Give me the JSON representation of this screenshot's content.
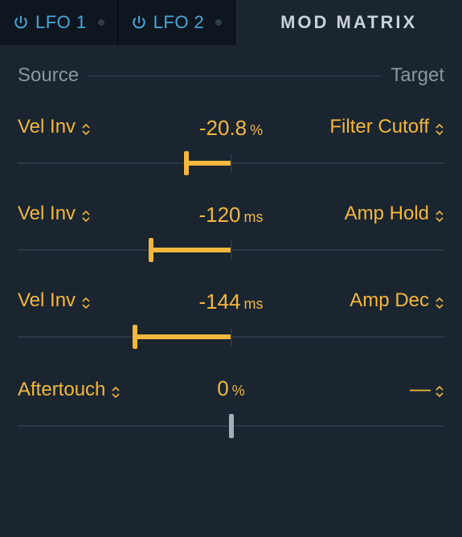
{
  "tabs": {
    "lfo1": "LFO 1",
    "lfo2": "LFO 2",
    "matrix": "MOD MATRIX"
  },
  "header": {
    "source": "Source",
    "target": "Target"
  },
  "rows": [
    {
      "source": "Vel Inv",
      "value": "-20.8",
      "unit": "%",
      "target": "Filter Cutoff",
      "pos": 39.6,
      "dash": false
    },
    {
      "source": "Vel Inv",
      "value": "-120",
      "unit": "ms",
      "target": "Amp Hold",
      "pos": 31.3,
      "dash": false
    },
    {
      "source": "Vel Inv",
      "value": "-144",
      "unit": "ms",
      "target": "Amp Dec",
      "pos": 27.5,
      "dash": false
    },
    {
      "source": "Aftertouch",
      "value": "0",
      "unit": "%",
      "target": "—",
      "pos": 50.0,
      "dash": true
    }
  ],
  "colors": {
    "accent": "#f3b73e",
    "tabBlue": "#4aa8d8",
    "bg": "#1a2530"
  }
}
